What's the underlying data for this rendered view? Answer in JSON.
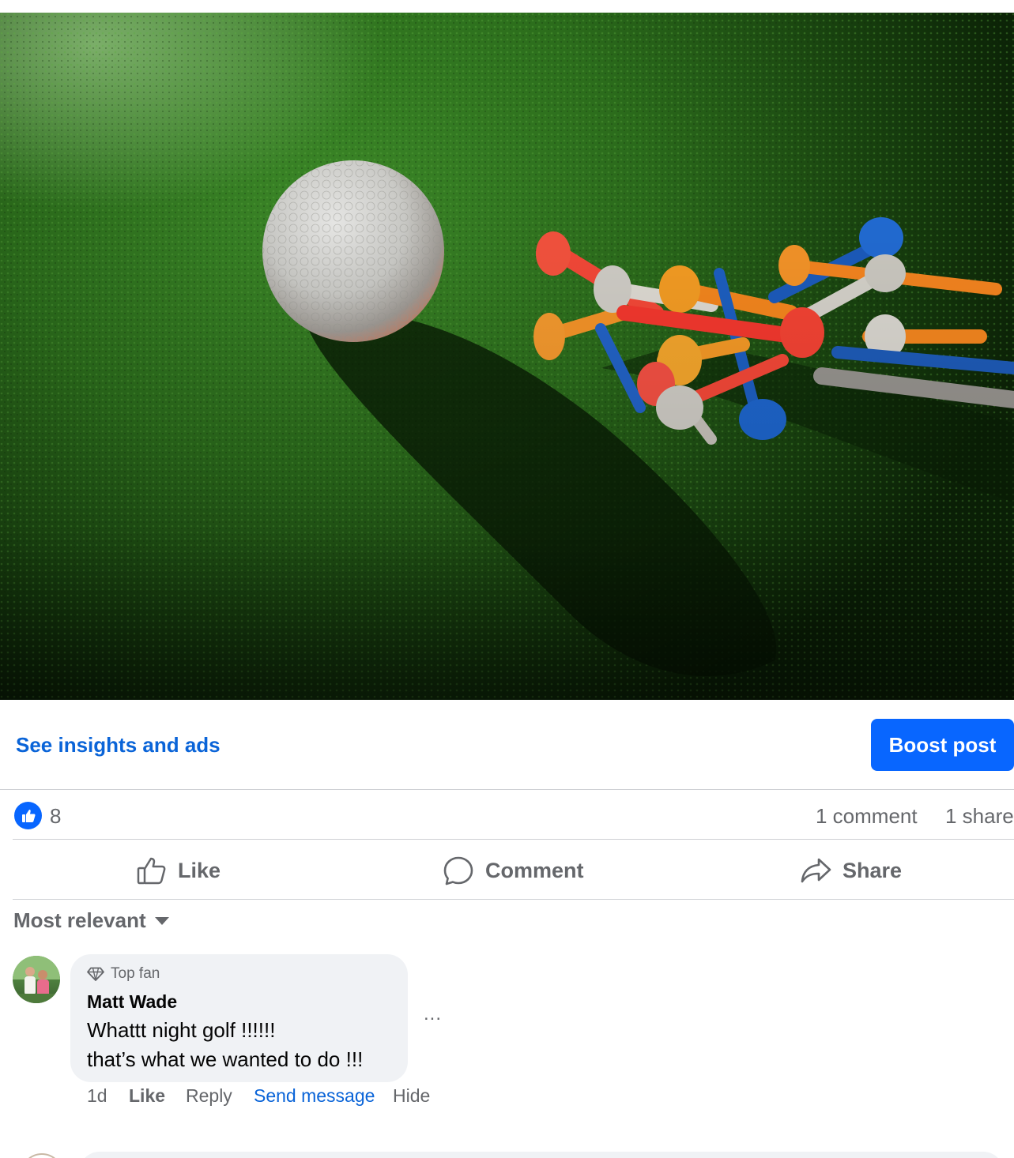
{
  "post": {
    "insights_link": "See insights and ads",
    "boost_button": "Boost post",
    "reaction_count": "8",
    "comment_count": "1 comment",
    "share_count": "1 share"
  },
  "actions": {
    "like": "Like",
    "comment": "Comment",
    "share": "Share"
  },
  "comments": {
    "sort_label": "Most relevant",
    "items": [
      {
        "badge": "Top fan",
        "author": "Matt Wade",
        "text": "Whattt night golf !!!!!!\nthat’s what we wanted to do !!!",
        "time": "1d",
        "like": "Like",
        "reply": "Reply",
        "send_message": "Send message",
        "hide": "Hide",
        "more": "..."
      }
    ]
  },
  "colors": {
    "primary_blue": "#0866ff",
    "link_blue": "#0a64d8",
    "secondary_text": "#65676b",
    "bubble_bg": "#f0f2f5"
  }
}
